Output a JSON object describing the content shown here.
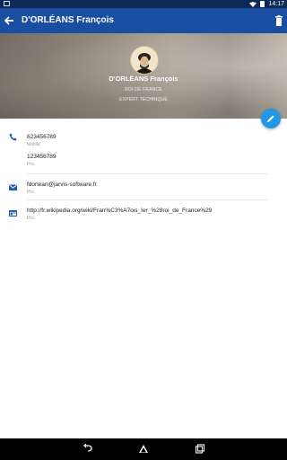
{
  "status_bar": {
    "time": "14:17"
  },
  "app_bar": {
    "title": "D'ORLÉANS François"
  },
  "header": {
    "name": "D'ORLÉANS François",
    "role": "ROI DE FRANCE",
    "company": "EXPERT TECHNIQUE"
  },
  "phones": [
    {
      "number": "623456789",
      "type": "Mobile"
    },
    {
      "number": "123456789",
      "type": "Pro."
    }
  ],
  "email": {
    "address": "fdorlean@jarvis-software.fr",
    "type": "Pro."
  },
  "website": {
    "url": "http://fr.wikipedia.org/wiki/Fran%C3%A7ois_Ier_%28roi_de_France%29",
    "type": "Pro."
  },
  "colors": {
    "status_bar": "#0d2a57",
    "app_bar": "#1a4ea0",
    "fab": "#2296e8",
    "icon": "#1a5fb4"
  }
}
